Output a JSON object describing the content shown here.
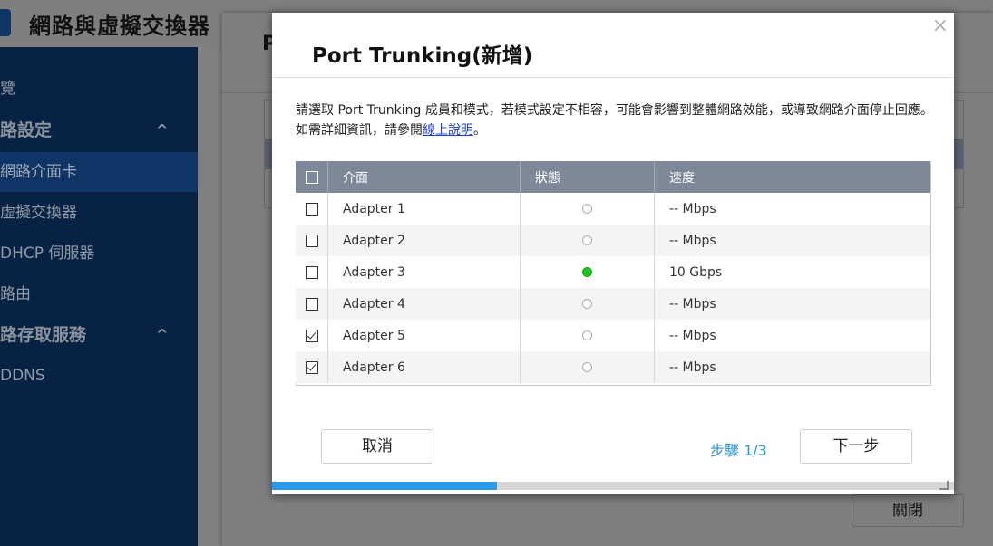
{
  "app": {
    "title": "網路與虛擬交換器",
    "window_controls": "– ×"
  },
  "sidebar": {
    "items": [
      {
        "label": "覽",
        "type": "item"
      },
      {
        "label": "路設定",
        "type": "section",
        "chevron": "^"
      },
      {
        "label": "網路介面卡",
        "type": "item",
        "active": true
      },
      {
        "label": "虛擬交換器",
        "type": "item"
      },
      {
        "label": "DHCP 伺服器",
        "type": "item"
      },
      {
        "label": "路由",
        "type": "item"
      },
      {
        "label": "路存取服務",
        "type": "section",
        "chevron": "^"
      },
      {
        "label": "DDNS",
        "type": "item"
      }
    ]
  },
  "background_window": {
    "title": "P",
    "close_label": "關閉"
  },
  "dialog": {
    "title": "Port Trunking(新增)",
    "close_icon": "×",
    "description_prefix": "請選取 Port Trunking 成員和模式，若模式設定不相容，可能會影響到整體網路效能，或導致網路介面停止回應。如需詳細資訊，請參閱",
    "description_link": "線上說明",
    "description_suffix": "。",
    "table": {
      "headers": {
        "interface": "介面",
        "status": "狀態",
        "speed": "速度"
      },
      "rows": [
        {
          "name": "Adapter 1",
          "checked": false,
          "status": "off",
          "speed": "-- Mbps"
        },
        {
          "name": "Adapter 2",
          "checked": false,
          "status": "off",
          "speed": "-- Mbps"
        },
        {
          "name": "Adapter 3",
          "checked": false,
          "status": "on",
          "speed": "10 Gbps"
        },
        {
          "name": "Adapter 4",
          "checked": false,
          "status": "off",
          "speed": "-- Mbps"
        },
        {
          "name": "Adapter 5",
          "checked": true,
          "status": "off",
          "speed": "-- Mbps"
        },
        {
          "name": "Adapter 6",
          "checked": true,
          "status": "off",
          "speed": "-- Mbps"
        }
      ]
    },
    "cancel_label": "取消",
    "step_label": "步驟 1/3",
    "next_label": "下一步",
    "progress": 0.33
  },
  "colors": {
    "accent": "#2e9ae6",
    "status_on": "#1ec21e",
    "sidebar_bg": "#082244",
    "table_header_bg": "#7e8898"
  }
}
